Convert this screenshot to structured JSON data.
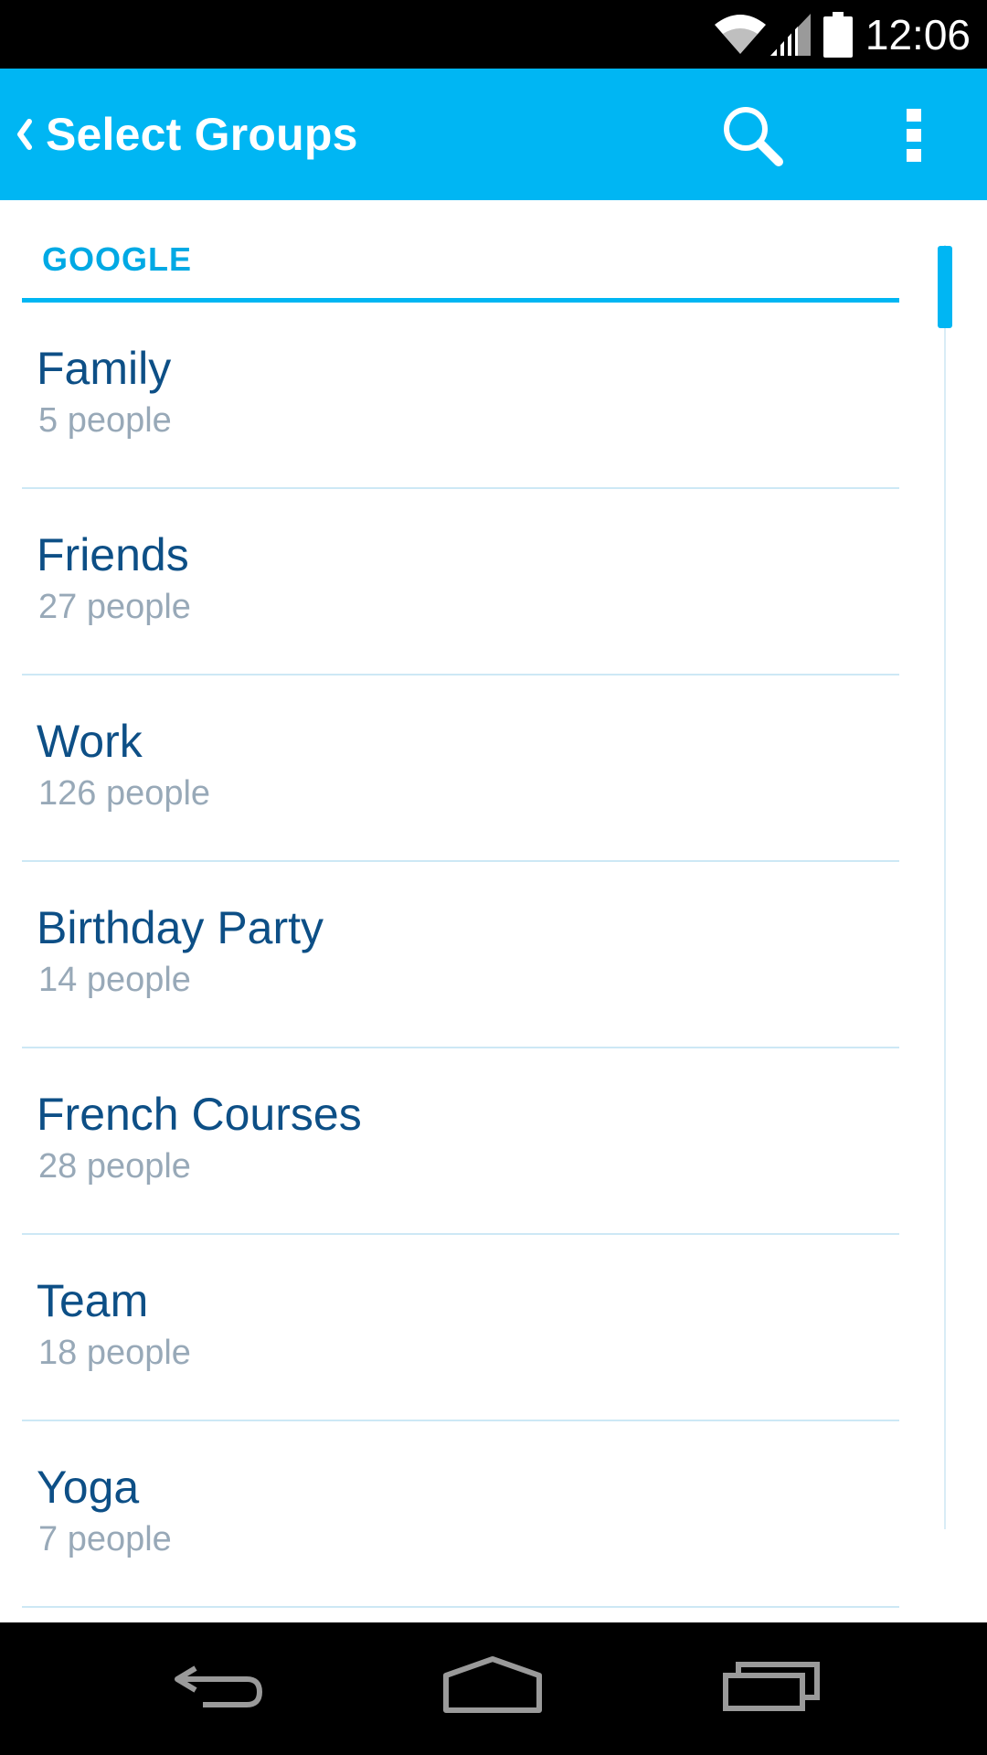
{
  "status_bar": {
    "time": "12:06",
    "icons": [
      "wifi-icon",
      "signal-icon",
      "battery-icon"
    ]
  },
  "action_bar": {
    "title": "Select Groups",
    "icons": [
      "chevron-left-icon",
      "search-icon",
      "overflow-menu-icon"
    ],
    "background": "#00b6f3"
  },
  "section": {
    "title": "GOOGLE"
  },
  "groups": [
    {
      "name": "Family",
      "count": "5 people"
    },
    {
      "name": "Friends",
      "count": "27 people"
    },
    {
      "name": "Work",
      "count": "126 people"
    },
    {
      "name": "Birthday Party",
      "count": "14 people"
    },
    {
      "name": "French Courses",
      "count": "28 people"
    },
    {
      "name": "Team",
      "count": "18 people"
    },
    {
      "name": "Yoga",
      "count": "7 people"
    }
  ],
  "nav_bar": {
    "icons": [
      "back-icon",
      "home-icon",
      "recents-icon"
    ]
  },
  "colors": {
    "accent": "#00b6f3",
    "item_name": "#0d4f86",
    "item_count": "#98a9b8",
    "divider": "#cde8f5"
  }
}
